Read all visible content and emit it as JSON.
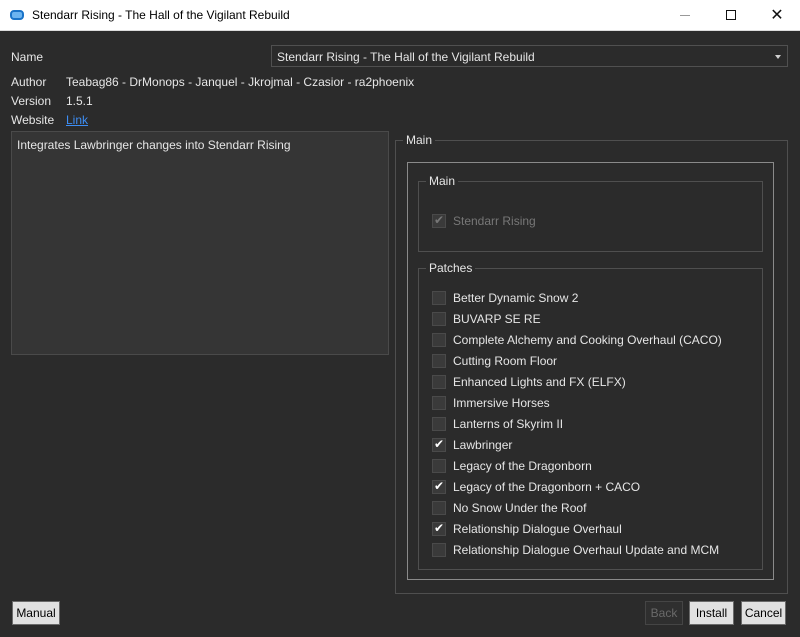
{
  "window": {
    "title": "Stendarr Rising - The Hall of the Vigilant Rebuild",
    "minimize": "",
    "maximize": "",
    "close": "✕"
  },
  "info": {
    "name_label": "Name",
    "name_value": "Stendarr Rising - The Hall of the Vigilant Rebuild",
    "author_label": "Author",
    "author_value": "Teabag86 - DrMonops - Janquel - Jkrojmal - Czasior - ra2phoenix",
    "version_label": "Version",
    "version_value": "1.5.1",
    "website_label": "Website",
    "website_link": "Link"
  },
  "description": "Integrates Lawbringer changes into Stendarr Rising",
  "step": {
    "title": "Main",
    "groups": [
      {
        "title": "Main",
        "options": [
          {
            "label": "Stendarr Rising",
            "checked": true,
            "disabled": true
          }
        ]
      },
      {
        "title": "Patches",
        "options": [
          {
            "label": "Better Dynamic Snow 2",
            "checked": false
          },
          {
            "label": "BUVARP SE RE",
            "checked": false
          },
          {
            "label": "Complete Alchemy and Cooking Overhaul (CACO)",
            "checked": false
          },
          {
            "label": "Cutting Room Floor",
            "checked": false
          },
          {
            "label": "Enhanced Lights and FX (ELFX)",
            "checked": false
          },
          {
            "label": "Immersive Horses",
            "checked": false
          },
          {
            "label": "Lanterns of Skyrim II",
            "checked": false
          },
          {
            "label": "Lawbringer",
            "checked": true
          },
          {
            "label": "Legacy of the Dragonborn",
            "checked": false
          },
          {
            "label": "Legacy of the Dragonborn + CACO",
            "checked": true
          },
          {
            "label": "No Snow Under the Roof",
            "checked": false
          },
          {
            "label": "Relationship Dialogue Overhaul",
            "checked": true
          },
          {
            "label": "Relationship Dialogue Overhaul Update and MCM",
            "checked": false
          }
        ]
      }
    ]
  },
  "buttons": {
    "manual": "Manual",
    "back": "Back",
    "install": "Install",
    "cancel": "Cancel"
  }
}
